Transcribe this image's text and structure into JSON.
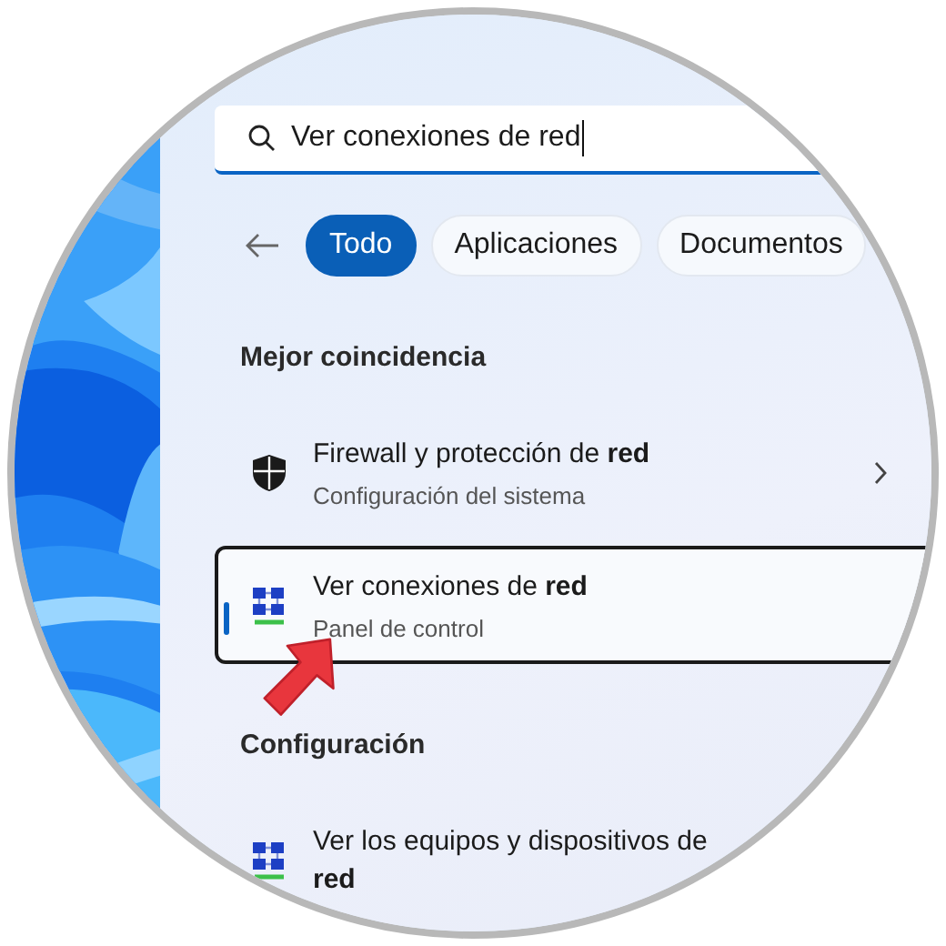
{
  "search": {
    "value": "Ver conexiones de red"
  },
  "filters": [
    {
      "label": "Todo",
      "selected": true
    },
    {
      "label": "Aplicaciones",
      "selected": false
    },
    {
      "label": "Documentos",
      "selected": false
    }
  ],
  "sections": [
    {
      "heading": "Mejor coincidencia",
      "results": [
        {
          "title": "Firewall y protección de **red**",
          "subtitle": "Configuración del sistema",
          "kind": "shield",
          "selected": false,
          "chevron": true
        },
        {
          "title": "Ver conexiones de **red**",
          "subtitle": "Panel de control",
          "kind": "network",
          "selected": true,
          "chevron": false
        }
      ]
    },
    {
      "heading": "Configuración",
      "results": [
        {
          "title": "Ver los equipos y dispositivos de **red**",
          "kind": "network",
          "selected": false,
          "chevron": false
        }
      ]
    }
  ]
}
